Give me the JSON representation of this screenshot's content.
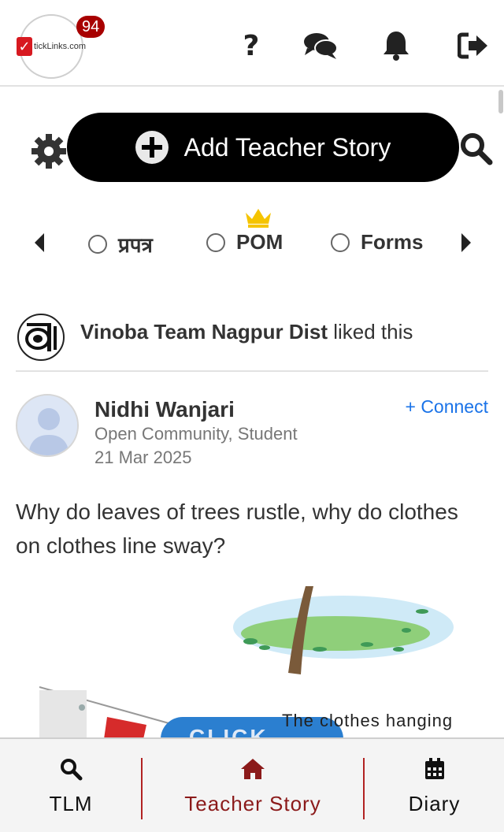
{
  "header": {
    "logo_text": "tickLinks.com",
    "notification_count": "94",
    "icons": [
      "help-icon",
      "chat-icon",
      "bell-icon",
      "logout-icon"
    ]
  },
  "actions": {
    "add_story_label": "Add Teacher Story"
  },
  "filters": {
    "items": [
      {
        "label": "प्रपत्र"
      },
      {
        "label": "POM"
      },
      {
        "label": "Forms"
      }
    ]
  },
  "activity": {
    "actor": "Vinoba Team Nagpur Dist",
    "action": "liked this"
  },
  "post": {
    "author": "Nidhi Wanjari",
    "role": "Open Community, Student",
    "date": "21 Mar 2025",
    "connect_label": "+ Connect",
    "text": "Why do leaves of trees rustle, why do clothes on clothes line sway?",
    "image_caption": "The clothes hanging",
    "image_overlay": "CLICK"
  },
  "bottom_nav": {
    "items": [
      {
        "label": "TLM"
      },
      {
        "label": "Teacher Story"
      },
      {
        "label": "Diary"
      }
    ]
  },
  "colors": {
    "accent": "#8b1a1a",
    "badge": "#a80000",
    "link": "#1a73e8",
    "add_button": "#000000"
  }
}
